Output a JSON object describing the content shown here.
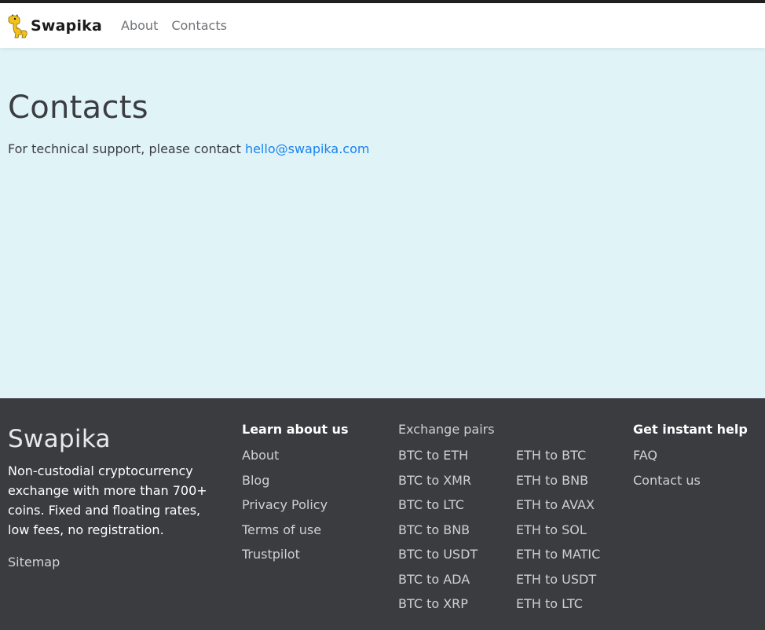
{
  "header": {
    "brand": "Swapika",
    "nav": [
      {
        "label": "About"
      },
      {
        "label": "Contacts"
      }
    ]
  },
  "main": {
    "title": "Contacts",
    "support_text": "For technical support, please contact ",
    "support_email": "hello@swapika.com"
  },
  "footer": {
    "brand": "Swapika",
    "description": "Non-custodial cryptocurrency exchange with more than 700+ coins. Fixed and floating rates, low fees, no registration.",
    "sitemap": "Sitemap",
    "learn": {
      "title": "Learn about us",
      "links": [
        "About",
        "Blog",
        "Privacy Policy",
        "Terms of use",
        "Trustpilot"
      ]
    },
    "pairs": {
      "title": "Exchange pairs",
      "col1": [
        "BTC to ETH",
        "BTC to XMR",
        "BTC to LTC",
        "BTC to BNB",
        "BTC to USDT",
        "BTC to ADA",
        "BTC to XRP"
      ],
      "col2": [
        "ETH to BTC",
        "ETH to BNB",
        "ETH to AVAX",
        "ETH to SOL",
        "ETH to MATIC",
        "ETH to USDT",
        "ETH to LTC"
      ]
    },
    "help": {
      "title": "Get instant help",
      "links": [
        "FAQ",
        "Contact us"
      ]
    }
  },
  "colors": {
    "page_bg": "#e0f3f7",
    "footer_bg": "#3b3c40",
    "link": "#1a83f0",
    "logo": "#f2c21a"
  },
  "icons": {
    "logo": "giraffe-logo-icon"
  }
}
